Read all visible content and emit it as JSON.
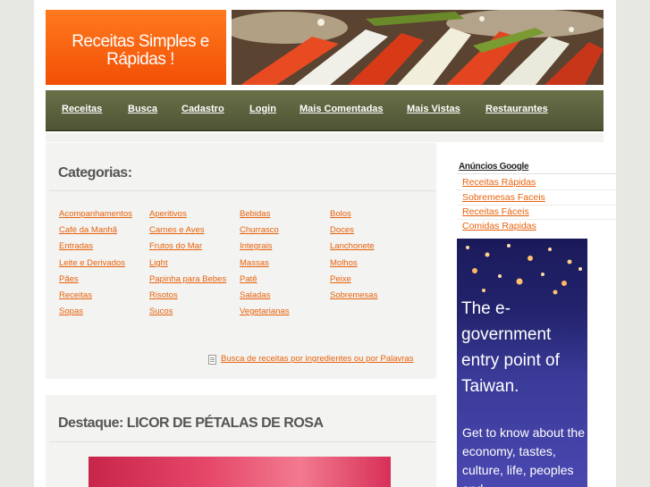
{
  "header": {
    "site_title": "Receitas Simples e Rápidas !"
  },
  "nav": {
    "items": [
      "Receitas",
      "Busca",
      "Cadastro",
      "Login",
      "Mais Comentadas",
      "Mais Vistas",
      "Restaurantes"
    ]
  },
  "categories": {
    "title": "Categorias:",
    "items": [
      "Acompanhamentos",
      "Aperitivos",
      "Bebidas",
      "Bolos",
      "Café da Manhã",
      "Carnes e Aves",
      "Churrasco",
      "Doces",
      "Entradas",
      "Frutos do Mar",
      "Integrais",
      "Lanchonete",
      "Leite e Derivados",
      "Light",
      "Massas",
      "Molhos",
      "Pães",
      "Papinha para Bebes",
      "Patê",
      "Peixe",
      "Receitas",
      "Risotos",
      "Saladas",
      "Sobremesas",
      "Sopas",
      "Sucos",
      "Vegetarianas"
    ],
    "search_link": "Busca de receitas por ingredientes ou por Palavras"
  },
  "feature": {
    "title": "Destaque: LICOR DE PÉTALAS DE ROSA"
  },
  "sidebar": {
    "ads_title": "Anúncios Google",
    "ad_links": [
      "Receitas Rápidas",
      "Sobremesas Faceis",
      "Receitas Fáceis",
      "Comidas Rapidas"
    ],
    "banner": {
      "headline": "The e-government entry point of Taiwan.",
      "subtext": "Get to know about the economy, tastes, culture, life, peoples and"
    }
  },
  "colors": {
    "accent_orange": "#e8620c",
    "logo_orange": "#f24f05",
    "nav_olive": "#5a6040",
    "banner_blue": "#2a2a7e"
  }
}
